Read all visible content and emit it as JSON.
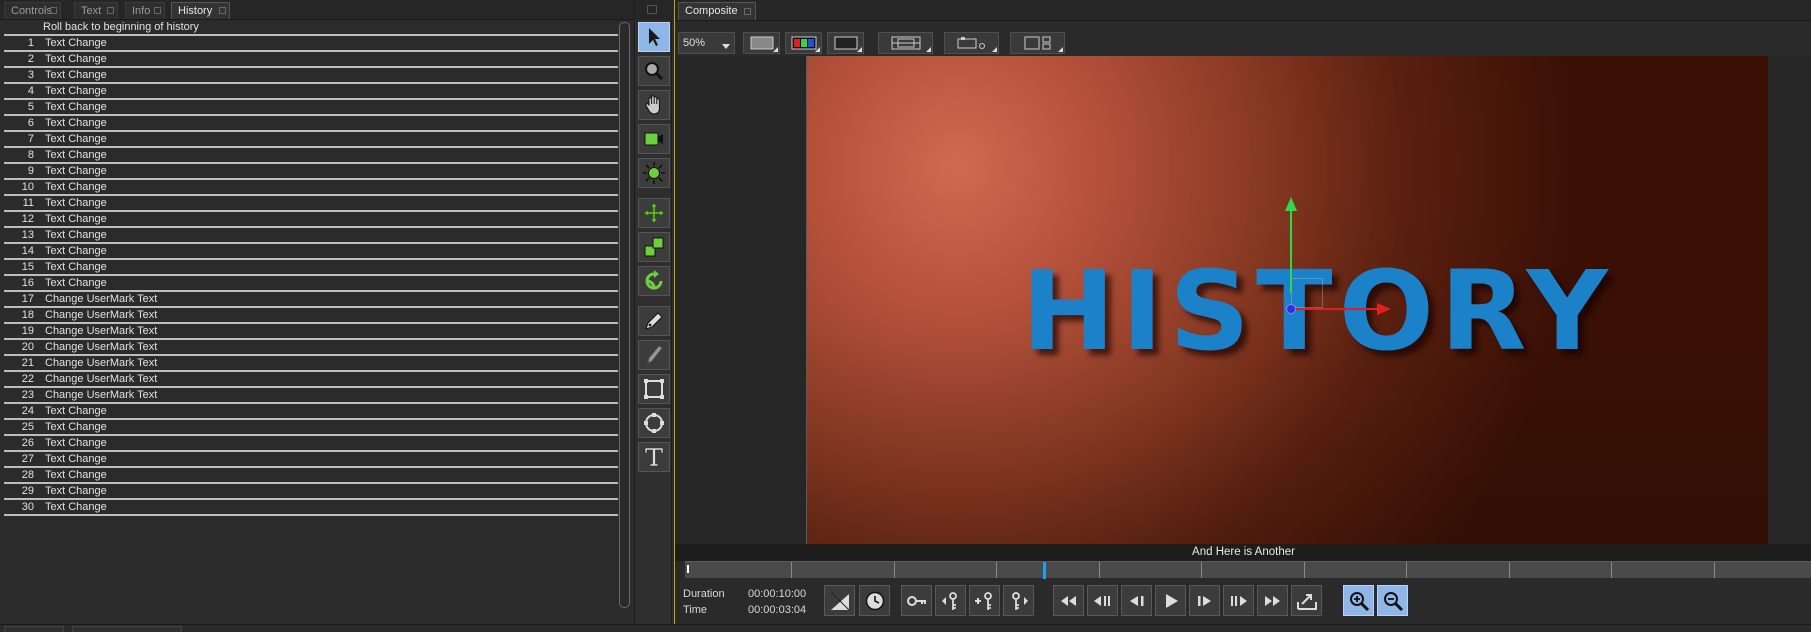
{
  "left_tabs": [
    {
      "label": "Controls",
      "active": false
    },
    {
      "label": "Text",
      "active": false
    },
    {
      "label": "Info",
      "active": false
    },
    {
      "label": "History",
      "active": true
    }
  ],
  "history": {
    "first_item": "Roll back to beginning of history",
    "items": [
      {
        "num": "1",
        "label": "Text Change"
      },
      {
        "num": "2",
        "label": "Text Change"
      },
      {
        "num": "3",
        "label": "Text Change"
      },
      {
        "num": "4",
        "label": "Text Change"
      },
      {
        "num": "5",
        "label": "Text Change"
      },
      {
        "num": "6",
        "label": "Text Change"
      },
      {
        "num": "7",
        "label": "Text Change"
      },
      {
        "num": "8",
        "label": "Text Change"
      },
      {
        "num": "9",
        "label": "Text Change"
      },
      {
        "num": "10",
        "label": "Text Change"
      },
      {
        "num": "11",
        "label": "Text Change"
      },
      {
        "num": "12",
        "label": "Text Change"
      },
      {
        "num": "13",
        "label": "Text Change"
      },
      {
        "num": "14",
        "label": "Text Change"
      },
      {
        "num": "15",
        "label": "Text Change"
      },
      {
        "num": "16",
        "label": "Text Change"
      },
      {
        "num": "17",
        "label": "Change UserMark Text"
      },
      {
        "num": "18",
        "label": "Change UserMark Text"
      },
      {
        "num": "19",
        "label": "Change UserMark Text"
      },
      {
        "num": "20",
        "label": "Change UserMark Text"
      },
      {
        "num": "21",
        "label": "Change UserMark Text"
      },
      {
        "num": "22",
        "label": "Change UserMark Text"
      },
      {
        "num": "23",
        "label": "Change UserMark Text"
      },
      {
        "num": "24",
        "label": "Text Change"
      },
      {
        "num": "25",
        "label": "Text Change"
      },
      {
        "num": "26",
        "label": "Text Change"
      },
      {
        "num": "27",
        "label": "Text Change"
      },
      {
        "num": "28",
        "label": "Text Change"
      },
      {
        "num": "29",
        "label": "Text Change"
      },
      {
        "num": "30",
        "label": "Text Change"
      }
    ]
  },
  "tools": [
    "arrow-select-icon",
    "magnifier-icon",
    "hand-pan-icon",
    "camera-icon",
    "light-icon",
    "move-icon",
    "scale-icon",
    "rotate-icon",
    "pen-icon",
    "pencil-icon",
    "rectangle-mask-icon",
    "ellipse-mask-icon",
    "text-tool-icon"
  ],
  "composite": {
    "tab_label": "Composite",
    "zoom": "50%",
    "viewport_text": "HISTORY",
    "marker_label": "And Here is Another",
    "duration_label": "Duration",
    "duration_value": "00:00:10:00",
    "time_label": "Time",
    "time_value": "00:00:03:04",
    "playhead_fraction": 0.318
  },
  "colors": {
    "accent_blue": "#8fb6e6",
    "title_blue": "#1b82c9",
    "gizmo_x": "#e02020",
    "gizmo_y": "#2fd84a",
    "playhead": "#1f9ef2",
    "panel_border": "#b8a800"
  }
}
